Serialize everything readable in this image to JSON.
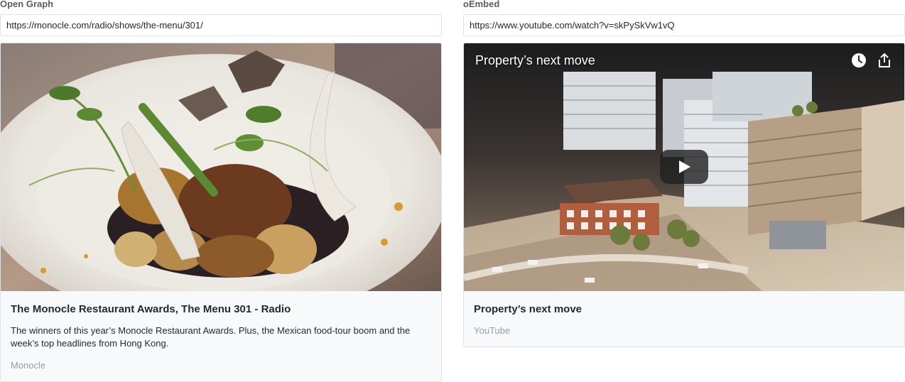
{
  "open_graph": {
    "section_label": "Open Graph",
    "url": "https://monocle.com/radio/shows/the-menu/301/",
    "card": {
      "title": "The Monocle Restaurant Awards, The Menu 301 - Radio",
      "description": "The winners of this year’s Monocle Restaurant Awards. Plus, the Mexican food-tour boom and the week’s top headlines from Hong Kong.",
      "provider": "Monocle",
      "image": "plated-food-dish-image"
    }
  },
  "oembed": {
    "section_label": "oEmbed",
    "url": "https://www.youtube.com/watch?v=skPySkVw1vQ",
    "card": {
      "video_title": "Property’s next move",
      "title": "Property’s next move",
      "provider": "YouTube",
      "video_thumbnail": "architectural-model-image",
      "icons": [
        "watch-later-icon",
        "share-icon",
        "play-icon"
      ]
    }
  }
}
